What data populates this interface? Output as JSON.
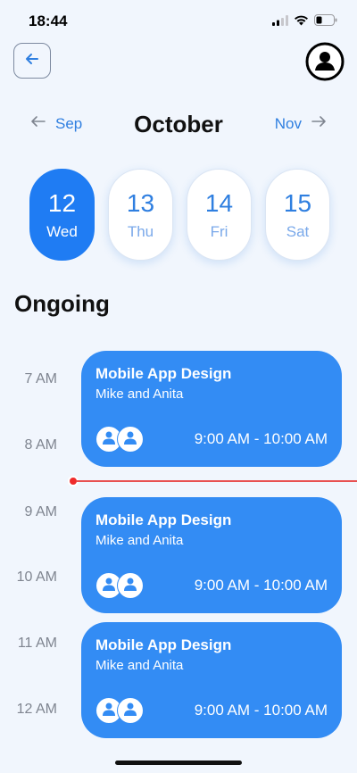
{
  "status": {
    "time": "18:44"
  },
  "header": {
    "back_icon": "arrow-left-icon",
    "profile_icon": "user-circle-icon"
  },
  "month_nav": {
    "prev": "Sep",
    "current": "October",
    "next": "Nov"
  },
  "days": [
    {
      "num": "12",
      "name": "Wed",
      "selected": true
    },
    {
      "num": "13",
      "name": "Thu",
      "selected": false
    },
    {
      "num": "14",
      "name": "Fri",
      "selected": false
    },
    {
      "num": "15",
      "name": "Sat",
      "selected": false
    }
  ],
  "section": {
    "title": "Ongoing"
  },
  "times": [
    "7 AM",
    "8 AM",
    "9 AM",
    "10 AM",
    "11 AM",
    "12 AM"
  ],
  "events": [
    {
      "title": "Mobile App Design",
      "people": "Mike and Anita",
      "time": "9:00 AM - 10:00 AM"
    },
    {
      "title": "Mobile App Design",
      "people": "Mike and Anita",
      "time": "9:00 AM - 10:00 AM"
    },
    {
      "title": "Mobile App Design",
      "people": "Mike and Anita",
      "time": "9:00 AM - 10:00 AM"
    }
  ],
  "colors": {
    "accent": "#1f7cf3",
    "card": "#338cf4",
    "now_line": "#e85151",
    "background": "#f1f6fd"
  }
}
